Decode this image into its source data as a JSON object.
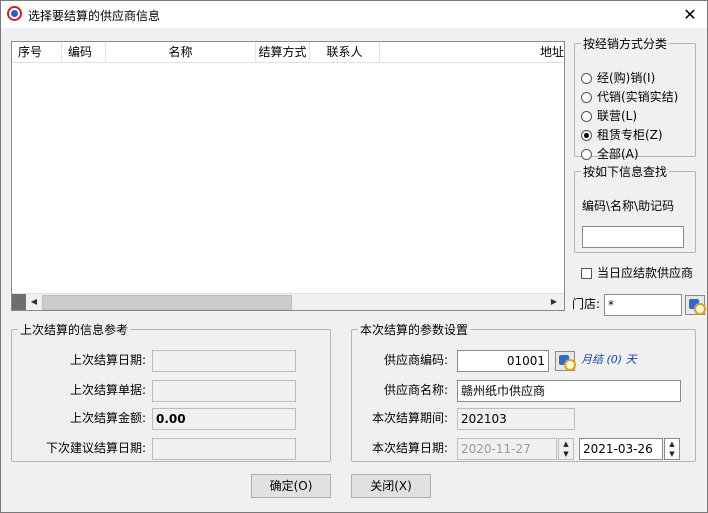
{
  "window": {
    "title": "选择要结算的供应商信息",
    "close_glyph": "✕"
  },
  "list": {
    "columns": [
      "序号",
      "编码",
      "名称",
      "结算方式",
      "联系人",
      "地址"
    ],
    "left_arrow": "◀",
    "right_arrow": "▶"
  },
  "classify": {
    "title": "按经销方式分类",
    "options": [
      {
        "label": "经(购)销(I)",
        "checked": false
      },
      {
        "label": "代销(实销实结)",
        "checked": false
      },
      {
        "label": "联营(L)",
        "checked": false
      },
      {
        "label": "租赁专柜(Z)",
        "checked": true
      },
      {
        "label": "全部(A)",
        "checked": false
      }
    ]
  },
  "search": {
    "title": "按如下信息查找",
    "label": "编码\\名称\\助记码",
    "value": ""
  },
  "today_settle": {
    "label": "当日应结款供应商",
    "checked": false
  },
  "store": {
    "label": "门店:",
    "value": "*"
  },
  "last": {
    "title": "上次结算的信息参考",
    "date_label": "上次结算日期:",
    "doc_label": "上次结算单据:",
    "amount_label": "上次结算金额:",
    "amount_value": "0.00",
    "next_label": "下次建议结算日期:"
  },
  "params": {
    "title": "本次结算的参数设置",
    "code_label": "供应商编码:",
    "code_value": "01001",
    "cycle_text": "月结 (0) 天",
    "name_label": "供应商名称:",
    "name_value": "赣州纸巾供应商",
    "period_label": "本次结算期间:",
    "period_value": "202103",
    "date_label": "本次结算日期:",
    "date_from": "2020-11-27",
    "date_to": "2021-03-26",
    "spin_up": "▲",
    "spin_down": "▼"
  },
  "buttons": {
    "ok": "确定(O)",
    "close": "关闭(X)"
  }
}
